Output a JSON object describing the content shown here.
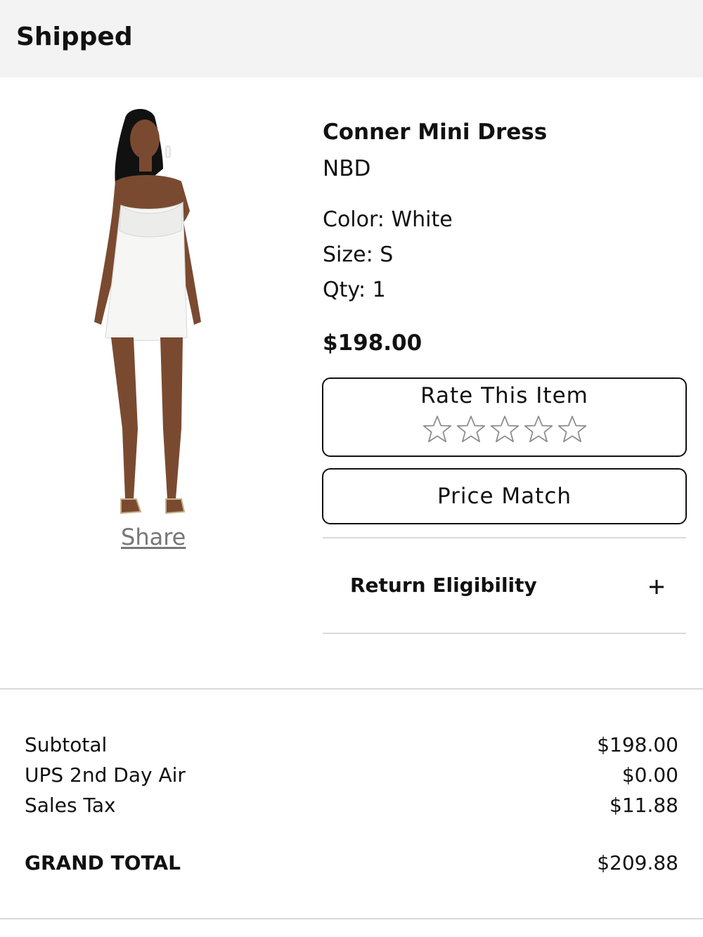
{
  "order": {
    "status": "Shipped"
  },
  "product": {
    "name": "Conner Mini Dress",
    "brand": "NBD",
    "color": "Color: White",
    "size": "Size: S",
    "qty": "Qty: 1",
    "price": "$198.00",
    "share_label": "Share"
  },
  "actions": {
    "rate_label": "Rate This Item",
    "rating": {
      "value": 0,
      "max": 5
    },
    "price_match_label": "Price Match",
    "return_label": "Return Eligibility"
  },
  "summary": {
    "rows": [
      {
        "label": "Subtotal",
        "value": "$198.00"
      },
      {
        "label": "UPS 2nd Day Air",
        "value": "$0.00"
      },
      {
        "label": "Sales Tax",
        "value": "$11.88"
      }
    ],
    "grand_total_label": "GRAND TOTAL",
    "grand_total_value": "$209.88"
  },
  "icons": {
    "star": "star-outline-icon",
    "expand": "plus-icon"
  },
  "colors": {
    "header_bg": "#f3f3f3",
    "text": "#111111",
    "share_link": "#777777",
    "divider": "#d9d9d9"
  }
}
